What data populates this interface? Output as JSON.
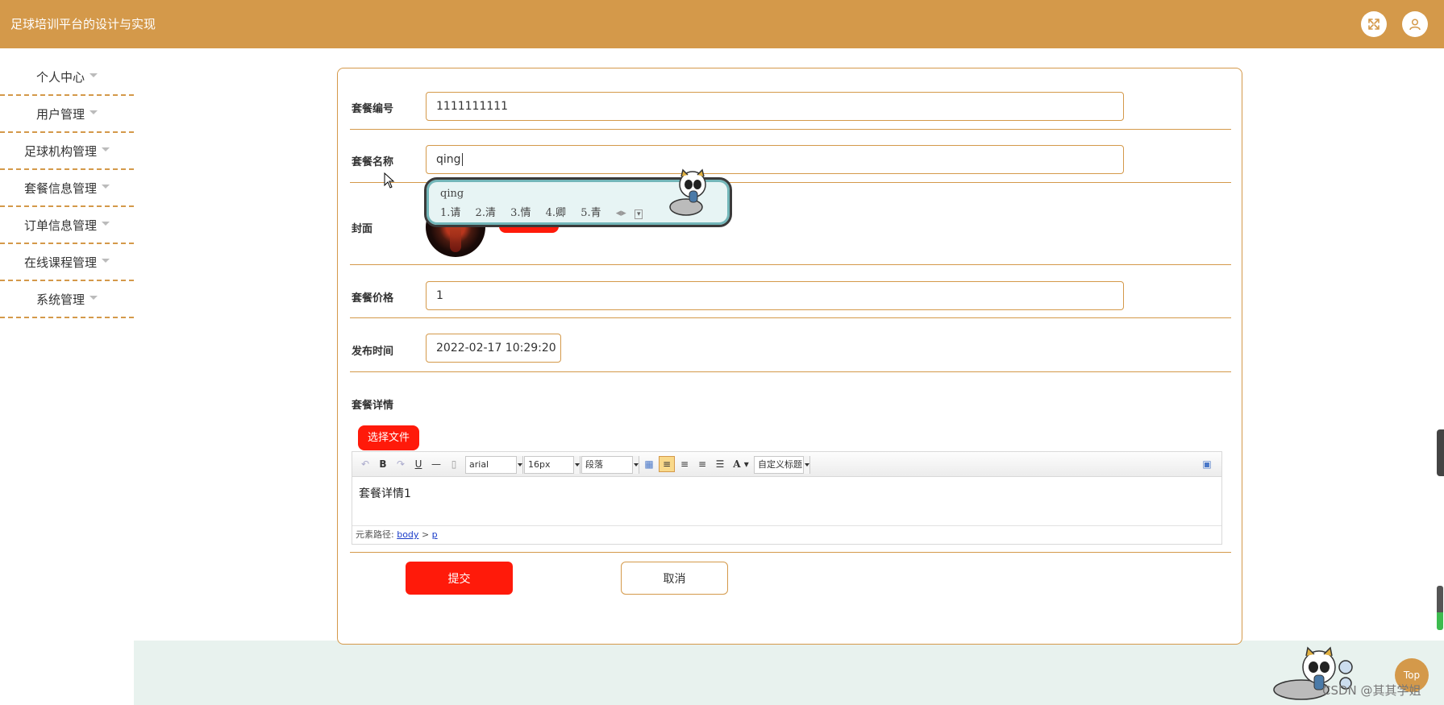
{
  "header": {
    "title": "足球培训平台的设计与实现",
    "fullscreen_icon": "fullscreen-icon",
    "user_icon": "user-icon"
  },
  "sidebar": {
    "items": [
      {
        "label": "个人中心"
      },
      {
        "label": "用户管理"
      },
      {
        "label": "足球机构管理"
      },
      {
        "label": "套餐信息管理"
      },
      {
        "label": "订单信息管理"
      },
      {
        "label": "在线课程管理"
      },
      {
        "label": "系统管理"
      }
    ]
  },
  "form": {
    "package_no": {
      "label": "套餐编号",
      "value": "1111111111"
    },
    "package_name": {
      "label": "套餐名称",
      "value": "qing"
    },
    "cover": {
      "label": "封面",
      "button": "选择文件"
    },
    "price": {
      "label": "套餐价格",
      "value": "1"
    },
    "publish_time": {
      "label": "发布时间",
      "value": "2022-02-17 10:29:20"
    },
    "details": {
      "label": "套餐详情",
      "upload_button": "选择文件"
    }
  },
  "editor": {
    "font_family": "arial",
    "font_size": "16px",
    "paragraph": "段落",
    "custom_heading": "自定义标题",
    "content": "套餐详情1",
    "path_label": "元素路径:",
    "path_body": "body",
    "path_sep": ">",
    "path_p": "p"
  },
  "actions": {
    "submit": "提交",
    "cancel": "取消"
  },
  "ime": {
    "typed": "qing",
    "candidates": [
      "1.请",
      "2.清",
      "3.情",
      "4.卿",
      "5.青"
    ]
  },
  "misc": {
    "top_button": "Top",
    "watermark": "CSDN @其其学姐"
  },
  "colors": {
    "accent": "#d4994a",
    "primary_button": "#ff1a0a",
    "bottom_band": "#e8f2ee"
  }
}
